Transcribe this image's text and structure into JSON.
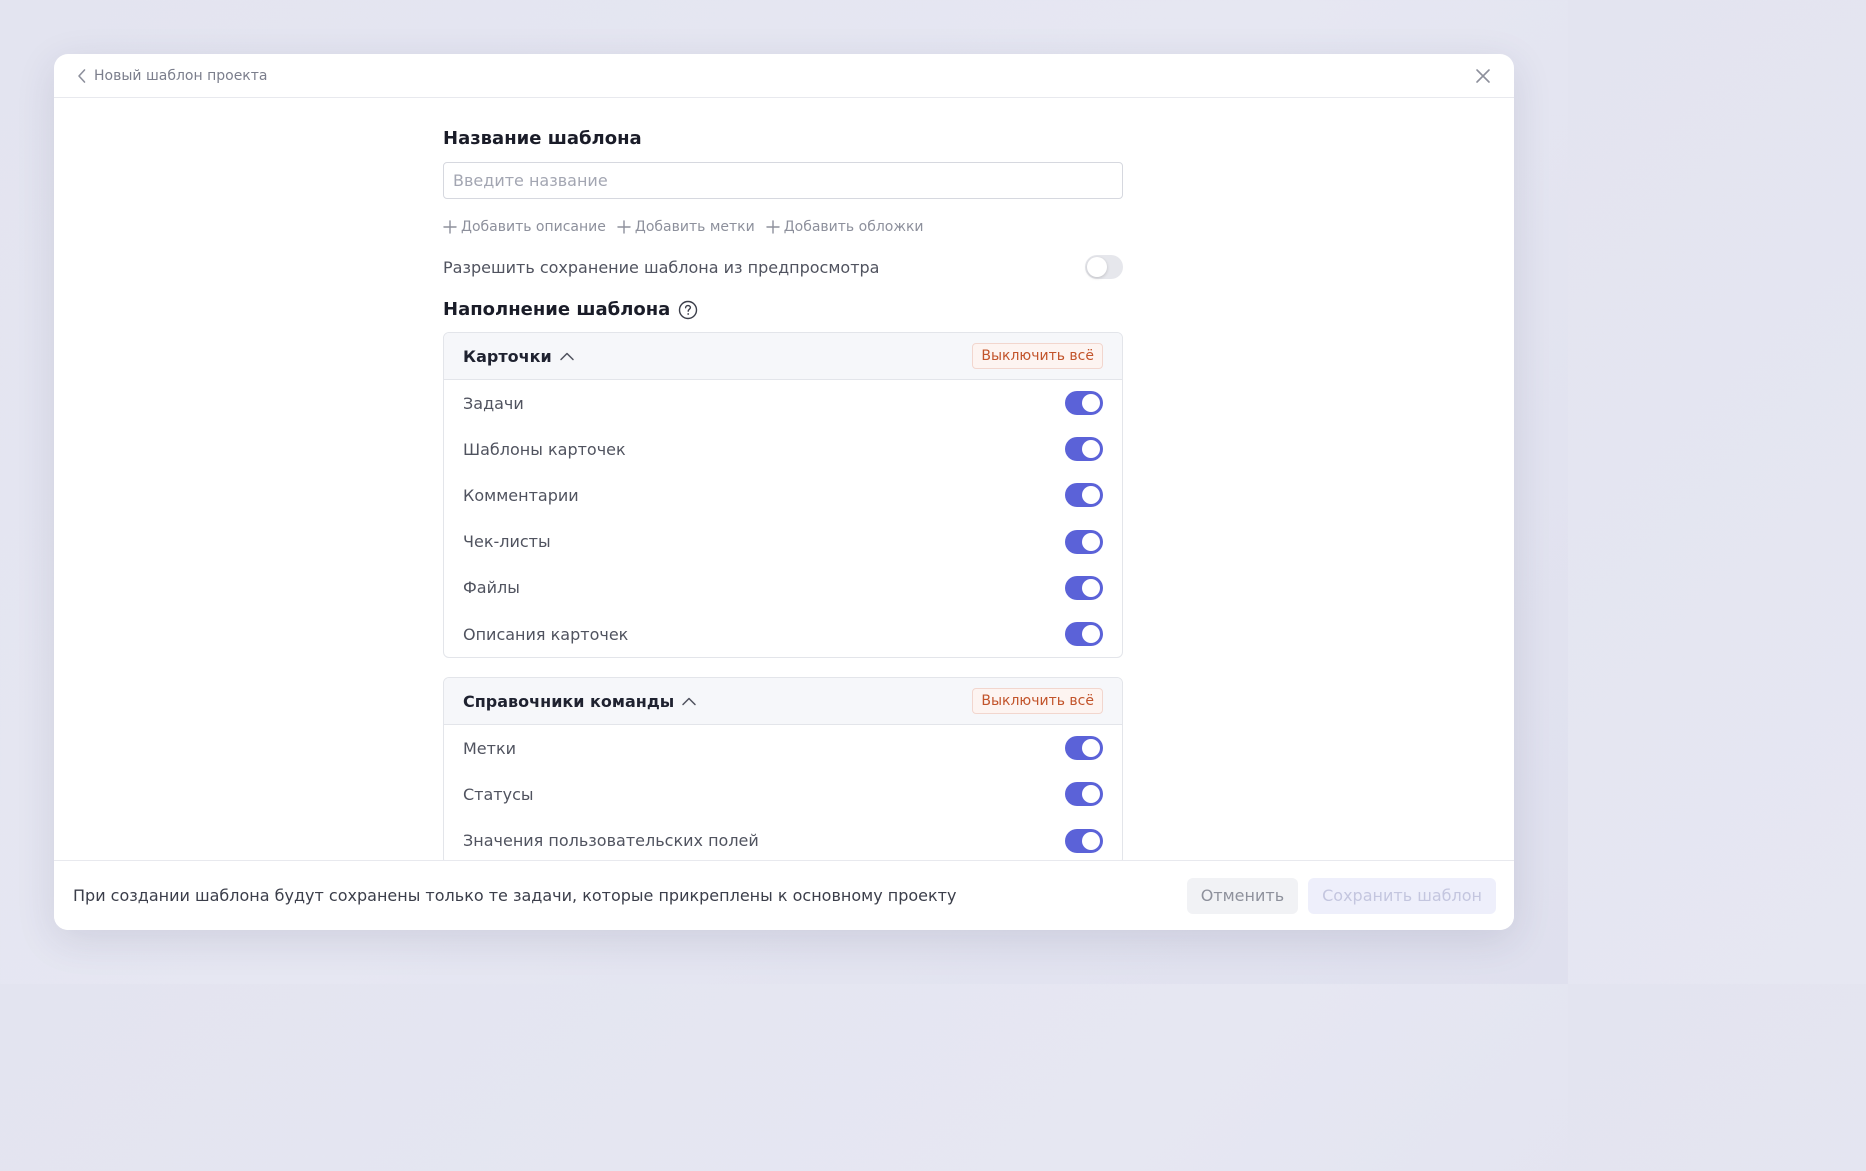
{
  "header": {
    "back_title": "Новый шаблон проекта"
  },
  "form": {
    "name_title": "Название шаблона",
    "name_placeholder": "Введите название",
    "name_value": "",
    "add_description": "Добавить описание",
    "add_tags": "Добавить метки",
    "add_covers": "Добавить обложки",
    "allow_preview_label": "Разрешить сохранение шаблона из предпросмотра",
    "allow_preview_enabled": false,
    "fill_title": "Наполнение шаблона"
  },
  "sections": [
    {
      "title": "Карточки",
      "disable_all_label": "Выключить всё",
      "items": [
        {
          "label": "Задачи",
          "enabled": true
        },
        {
          "label": "Шаблоны карточек",
          "enabled": true
        },
        {
          "label": "Комментарии",
          "enabled": true
        },
        {
          "label": "Чек-листы",
          "enabled": true
        },
        {
          "label": "Файлы",
          "enabled": true
        },
        {
          "label": "Описания карточек",
          "enabled": true
        }
      ]
    },
    {
      "title": "Справочники команды",
      "disable_all_label": "Выключить всё",
      "items": [
        {
          "label": "Метки",
          "enabled": true
        },
        {
          "label": "Статусы",
          "enabled": true
        },
        {
          "label": "Значения пользовательских полей",
          "enabled": true
        }
      ]
    }
  ],
  "footer": {
    "note": "При создании шаблона будут сохранены только те задачи, которые прикреплены к основному проекту",
    "cancel_label": "Отменить",
    "save_label": "Сохранить шаблон"
  },
  "colors": {
    "accent": "#5b62d8",
    "danger": "#c2542b"
  }
}
